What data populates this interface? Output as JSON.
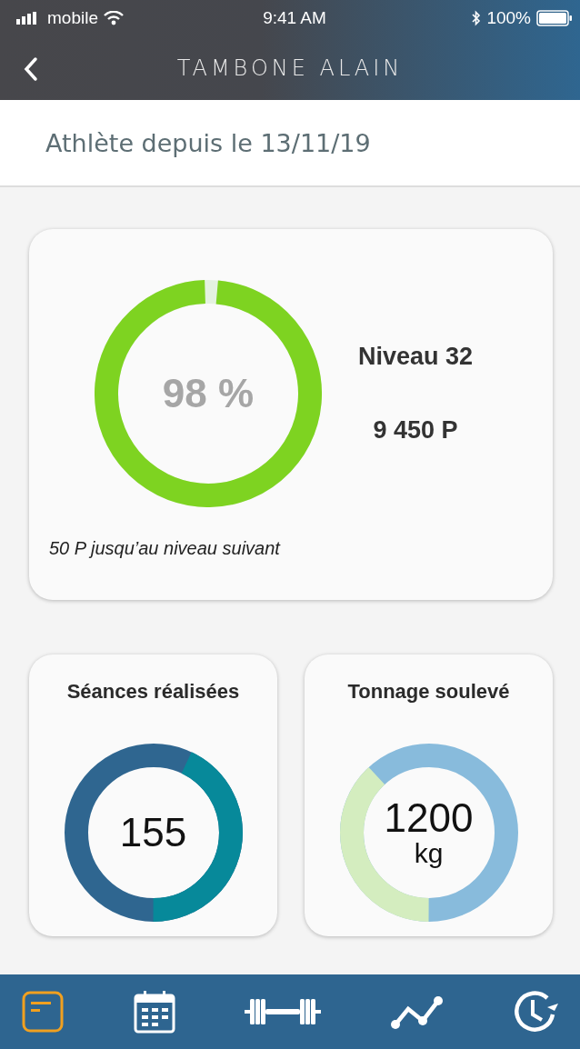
{
  "status_bar": {
    "carrier": "mobile",
    "time": "9:41 AM",
    "battery": "100%"
  },
  "nav": {
    "title": "TAMBONE ALAIN"
  },
  "header": {
    "text": "Athlète depuis le 13/11/19"
  },
  "level_card": {
    "percent": "98 %",
    "level_label": "Niveau 32",
    "points": "9 450 P",
    "note": "50 P jusqu’au niveau suivant"
  },
  "stat_cards": [
    {
      "title": "Séances réalisées",
      "value": "155",
      "kind": "sessions"
    },
    {
      "title": "Tonnage soulevé",
      "value": "1200",
      "unit": "kg",
      "kind": "tonnage"
    }
  ],
  "tab_bar": [
    {
      "kind": "notes",
      "selected": true
    },
    {
      "kind": "calendar",
      "selected": false
    },
    {
      "kind": "dumbbell",
      "selected": false
    },
    {
      "kind": "chart",
      "selected": false
    },
    {
      "kind": "history",
      "selected": false
    }
  ]
}
